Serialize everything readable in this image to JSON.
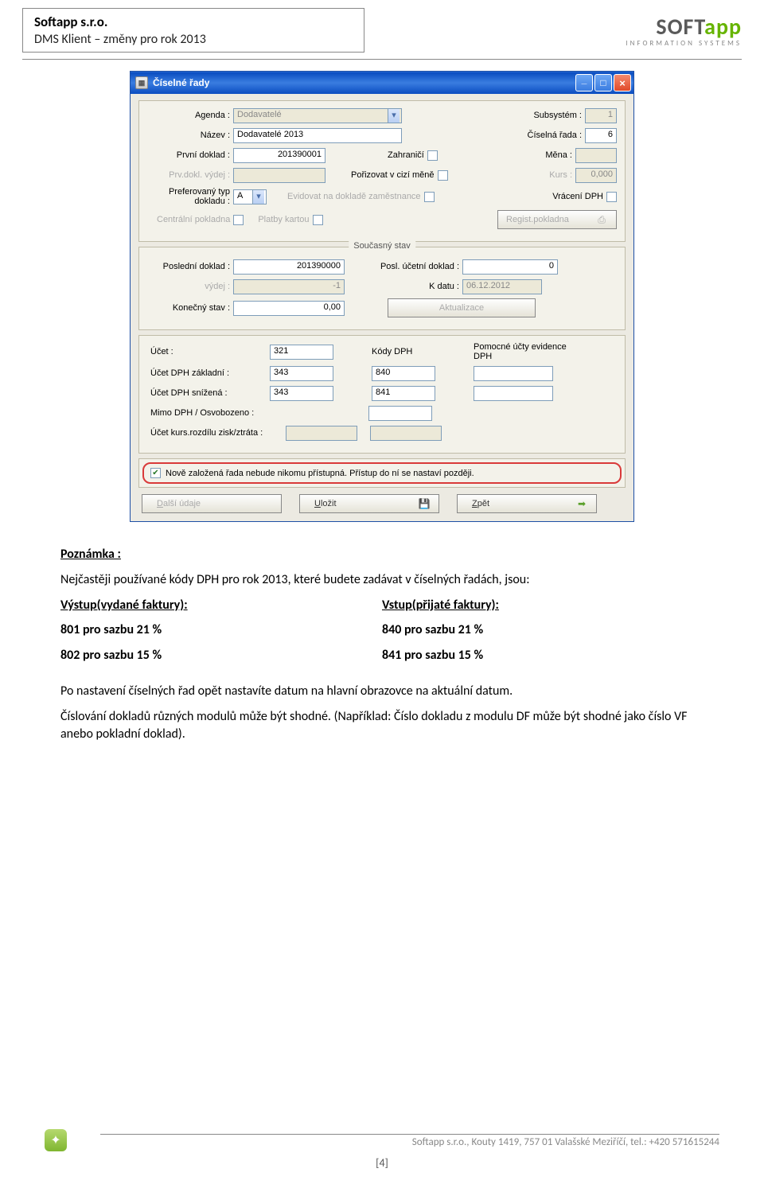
{
  "doc": {
    "company": "Softapp  s.r.o.",
    "subtitle": "DMS Klient – změny pro rok 2013",
    "logo_brand_a": "SOFT",
    "logo_brand_b": "app",
    "logo_sub": "INFORMATION SYSTEMS",
    "footer": "Softapp s.r.o., Kouty 1419, 757 01 Valašské Meziříčí, tel.: +420 571615244",
    "page_num": "[4]"
  },
  "dialog": {
    "title": "Číselné řady",
    "btn_min": "_",
    "btn_max": "□",
    "btn_close": "×",
    "labels": {
      "agenda": "Agenda :",
      "subsystem": "Subsystém :",
      "nazev": "Název :",
      "cis_rada": "Číselná řada :",
      "prvni_doklad": "První doklad :",
      "zahranici": "Zahraničí",
      "mena": "Měna :",
      "prv_vydej": "Prv.dokl. výdej :",
      "cizi_mena": "Pořizovat v cizí měně",
      "kurs": "Kurs :",
      "pref_typ": "Preferovaný typ dokladu :",
      "evid_zam": "Evidovat na dokladě zaměstnance",
      "vraceni_dph": "Vrácení DPH",
      "centr_pokl": "Centrální pokladna",
      "platby_kart": "Platby kartou",
      "regist_pokl": "Regist.pokladna",
      "soucasny_stav": "Současný stav",
      "posl_doklad": "Poslední doklad :",
      "posl_uc_doklad": "Posl. účetní doklad :",
      "vydej": "výdej :",
      "k_datu": "K datu :",
      "konecny_stav": "Konečný stav :",
      "aktualizace": "Aktualizace",
      "ucet": "Účet :",
      "kody_dph": "Kódy DPH",
      "pom_ucty": "Pomocné účty evidence DPH",
      "ucet_dph_zakl": "Účet DPH základní :",
      "ucet_dph_sniz": "Účet DPH snížená :",
      "mimo_dph": "Mimo DPH / Osvobozeno :",
      "ucet_kurs": "Účet kurs.rozdílu zisk/ztráta :"
    },
    "values": {
      "agenda": "Dodavatelé",
      "subsystem": "1",
      "nazev": "Dodavatelé 2013",
      "cis_rada": "6",
      "prvni_doklad": "201390001",
      "mena": "",
      "prv_vydej": "",
      "kurs": "0,000",
      "pref_typ": "A",
      "posl_doklad": "201390000",
      "posl_uc_doklad": "0",
      "vydej": "-1",
      "k_datu": "06.12.2012",
      "konecny_stav": "0,00",
      "ucet": "321",
      "ucet_dph_zakl": "343",
      "kod_dph_zakl": "840",
      "ucet_dph_sniz": "343",
      "kod_dph_sniz": "841"
    },
    "highlight": "Nově založená řada nebude nikomu přístupná. Přístup do ní se nastaví později.",
    "buttons": {
      "dalsi": "Další údaje",
      "ulozit": "Uložit",
      "zpet": "Zpět"
    }
  },
  "text": {
    "poznamka": "Poznámka :",
    "intro": "Nejčastěji používané kódy DPH pro rok 2013, které budete zadávat v číselných řadách, jsou:",
    "col1_head": "Výstup(vydané faktury):",
    "col2_head": "Vstup(přijaté faktury):",
    "c1l1": "801  pro sazbu  21 %",
    "c2l1": "840  pro sazbu  21 %",
    "c1l2": "802  pro sazbu  15 %",
    "c2l2": "841  pro sazbu  15 %",
    "para1": "Po nastavení číselných řad opět nastavíte datum na hlavní obrazovce na aktuální datum.",
    "para2": "Číslování dokladů různých modulů může být shodné. (Například: Číslo dokladu z modulu DF může být shodné jako číslo VF anebo pokladní doklad)."
  }
}
